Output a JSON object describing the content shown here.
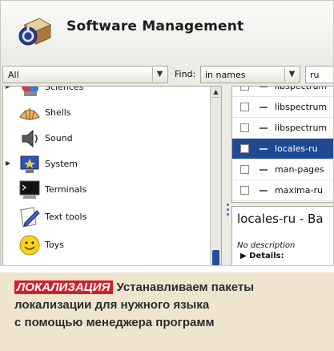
{
  "app": {
    "title": "Software Management"
  },
  "toolbar": {
    "group_select": "All",
    "find_label": "Find:",
    "find_mode": "in names",
    "search_value": "ru"
  },
  "categories": [
    {
      "label": "Sciences",
      "expandable": true,
      "icon": "sciences-icon"
    },
    {
      "label": "Shells",
      "expandable": false,
      "icon": "shell-icon"
    },
    {
      "label": "Sound",
      "expandable": false,
      "icon": "speaker-icon"
    },
    {
      "label": "System",
      "expandable": true,
      "icon": "system-icon"
    },
    {
      "label": "Terminals",
      "expandable": false,
      "icon": "terminal-icon"
    },
    {
      "label": "Text tools",
      "expandable": false,
      "icon": "text-editor-icon"
    },
    {
      "label": "Toys",
      "expandable": false,
      "icon": "smiley-icon"
    }
  ],
  "packages": [
    {
      "name": "libspectrum",
      "selected": false
    },
    {
      "name": "libspectrum",
      "selected": false
    },
    {
      "name": "libspectrum",
      "selected": false
    },
    {
      "name": "locales-ru",
      "selected": true
    },
    {
      "name": "man-pages",
      "selected": false
    },
    {
      "name": "maxima-ru",
      "selected": false
    }
  ],
  "details": {
    "title": "locales-ru - Ba",
    "description": "No description",
    "details_label": "Details:"
  },
  "caption": {
    "tag": "ЛОКАЛИЗАЦИЯ",
    "line1": "Устанавливаем пакеты",
    "line2": "локализации для нужного языка",
    "line3": "с помощью менеджера программ"
  },
  "colors": {
    "selection": "#1e4a95",
    "scroll_thumb": "#1f4f9b",
    "tag_red": "#d0212a",
    "caption_bg": "#efe5cf"
  }
}
